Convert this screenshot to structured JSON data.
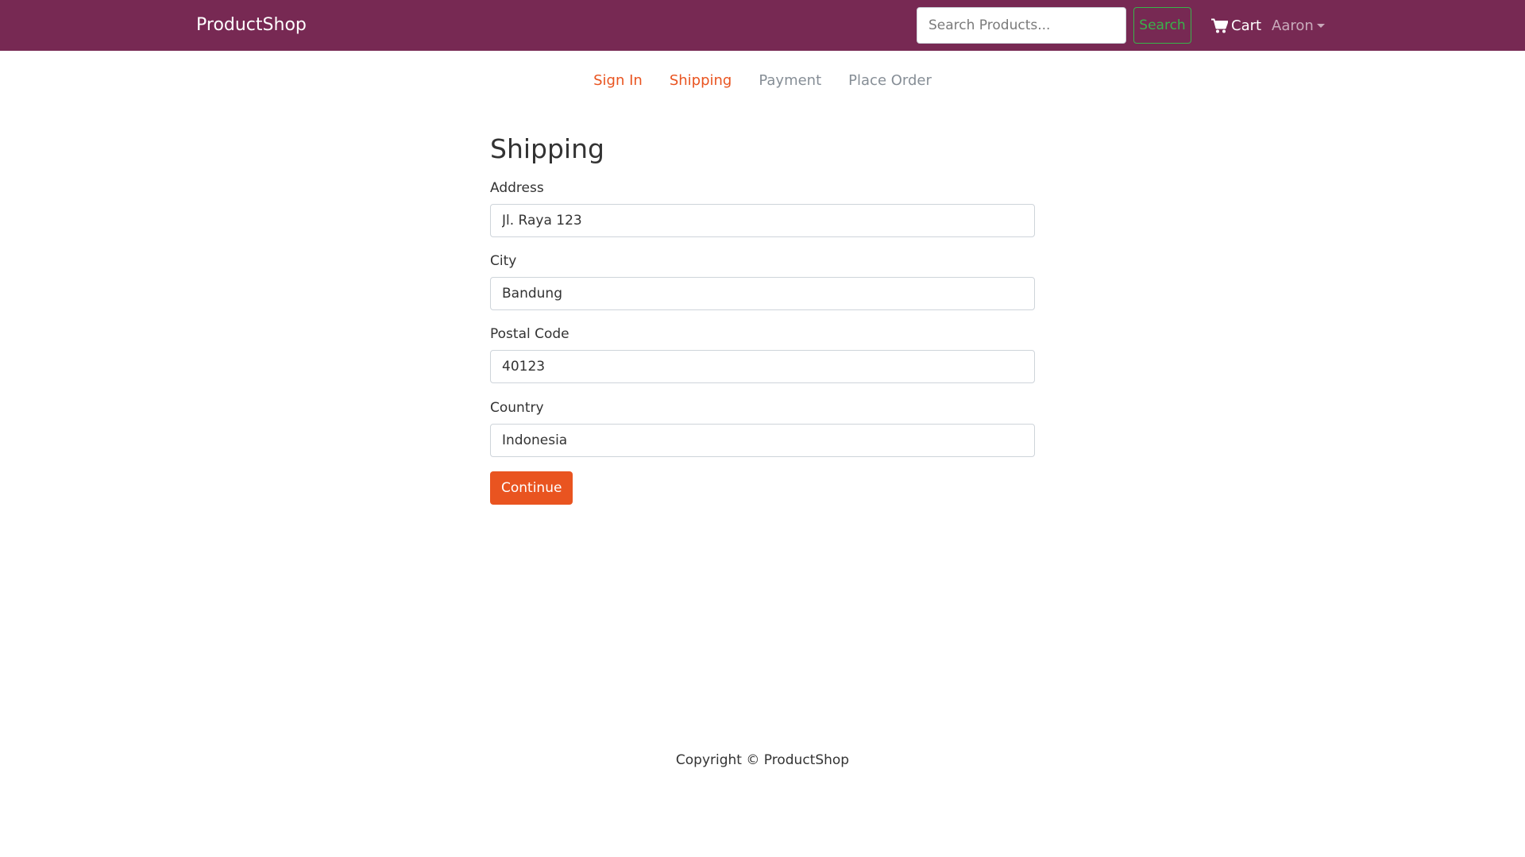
{
  "navbar": {
    "brand": "ProductShop",
    "search": {
      "placeholder": "Search Products...",
      "value": "",
      "button_label": "Search"
    },
    "cart_label": "Cart",
    "user_label": "Aaron"
  },
  "steps": [
    {
      "label": "Sign In",
      "state": "active"
    },
    {
      "label": "Shipping",
      "state": "active"
    },
    {
      "label": "Payment",
      "state": "disabled"
    },
    {
      "label": "Place Order",
      "state": "disabled"
    }
  ],
  "form": {
    "title": "Shipping",
    "fields": {
      "address": {
        "label": "Address",
        "value": "Jl. Raya 123"
      },
      "city": {
        "label": "City",
        "value": "Bandung"
      },
      "postal_code": {
        "label": "Postal Code",
        "value": "40123"
      },
      "country": {
        "label": "Country",
        "value": "Indonesia"
      }
    },
    "submit_label": "Continue"
  },
  "footer": {
    "copyright": "Copyright © ProductShop"
  },
  "colors": {
    "navbar_bg": "#772953",
    "accent": "#e95420",
    "search_button": "#38b44a",
    "step_disabled": "#868e96"
  }
}
